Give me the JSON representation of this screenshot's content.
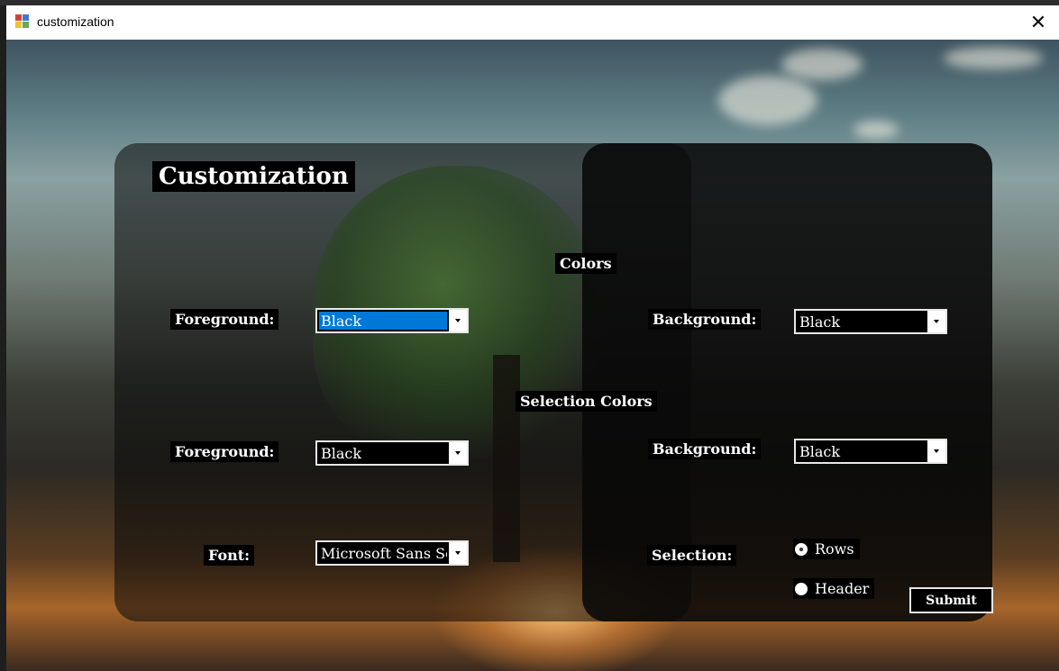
{
  "window": {
    "title": "customization",
    "close_glyph": "✕"
  },
  "icons": {
    "app": "app-form-icon",
    "close": "close-icon",
    "dropdown": "chevron-down-icon"
  },
  "form": {
    "heading": "Customization",
    "colors_section": "Colors",
    "selection_colors_section": "Selection Colors",
    "colors": {
      "foreground_label": "Foreground:",
      "foreground_value": "Black",
      "background_label": "Background:",
      "background_value": "Black"
    },
    "selection_colors": {
      "foreground_label": "Foreground:",
      "foreground_value": "Black",
      "background_label": "Background:",
      "background_value": "Black"
    },
    "font": {
      "label": "Font:",
      "value": "Microsoft Sans Seri"
    },
    "selection": {
      "label": "Selection:",
      "options": [
        {
          "label": "Rows",
          "checked": true
        },
        {
          "label": "Header",
          "checked": false
        }
      ]
    },
    "submit_label": "Submit"
  },
  "colors": {
    "highlight": "#0078d7",
    "panel_dark": "#000000",
    "text": "#ffffff"
  }
}
